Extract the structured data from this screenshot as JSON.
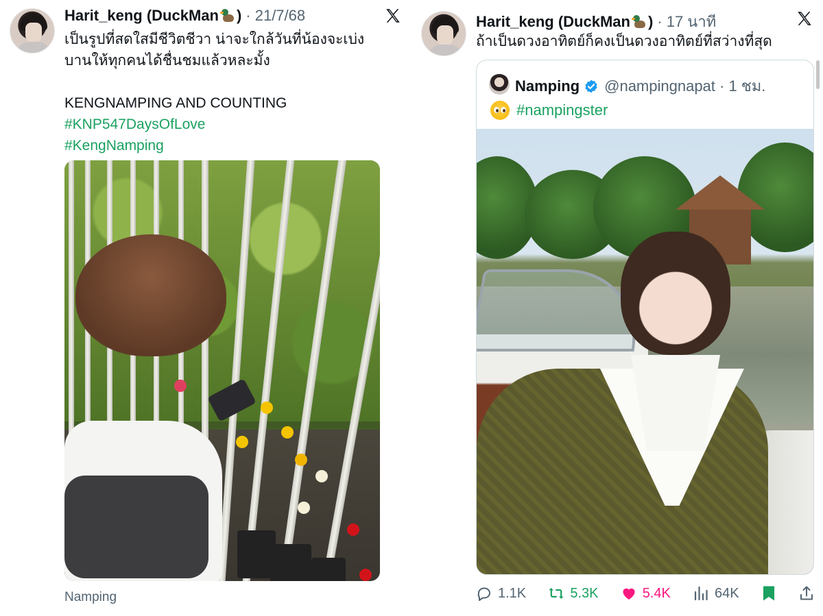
{
  "left": {
    "author": {
      "display_name": "Harit_keng (DuckMan",
      "close_paren": ")",
      "time": "· 21/7/68"
    },
    "text_line1": "เป็นรูปที่สดใสมีชีวิตชีวา น่าจะใกล้วันที่น้องจะเบ่ง",
    "text_line2": "บานให้ทุกคนได้ชื่นชมแล้วหละมั้ง",
    "text_line3": "KENGNAMPING AND COUNTING",
    "hashtag1": "#KNP547DaysOfLove",
    "hashtag2": "#KengNamping",
    "caption": "Namping"
  },
  "right": {
    "author": {
      "display_name": "Harit_keng (DuckMan",
      "close_paren": ")",
      "time": "· 17 นาที"
    },
    "text": "ถ้าเป็นดวงอาทิตย์ก็คงเป็นดวงอาทิตย์ที่สว่างที่สุด",
    "quote": {
      "name": "Namping",
      "handle": "@nampingnapat · 1 ชม.",
      "hashtag": "#nampingster"
    },
    "actions": {
      "replies": "1.1K",
      "reposts": "5.3K",
      "likes": "5.4K",
      "views": "64K"
    }
  },
  "colors": {
    "hashtag": "#1aa160",
    "like": "#f91880",
    "muted": "#536471",
    "repost": "#1aa160"
  },
  "icons": [
    "x-logo",
    "duck-emoji",
    "verified-badge",
    "pleading-face-emoji",
    "reply-icon",
    "repost-icon",
    "like-icon",
    "views-icon",
    "bookmark-icon",
    "share-icon"
  ]
}
